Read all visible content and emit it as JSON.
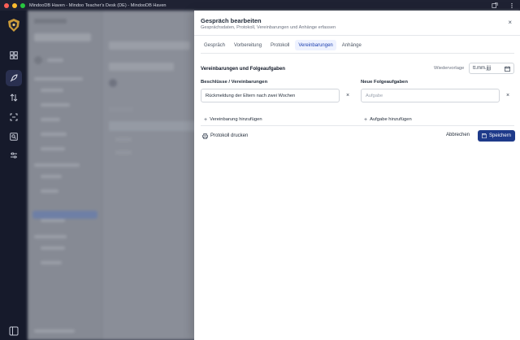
{
  "window": {
    "title": "MindooDB Haven - Mindoo Teacher's Desk (DE) - MindooDB Haven"
  },
  "rail": {
    "items": [
      {
        "icon": "dashboard-icon",
        "active": false
      },
      {
        "icon": "rocket-icon",
        "active": true
      },
      {
        "icon": "swap-icon",
        "active": false
      },
      {
        "icon": "scan-icon",
        "active": false
      },
      {
        "icon": "search-db-icon",
        "active": false
      },
      {
        "icon": "sliders-icon",
        "active": false
      }
    ]
  },
  "panel": {
    "title": "Gespräch bearbeiten",
    "subtitle": "Gesprächsdaten, Protokoll, Vereinbarungen und Anhänge erfassen",
    "close_label": "×",
    "tabs": [
      {
        "label": "Gespräch",
        "active": false
      },
      {
        "label": "Vorbereitung",
        "active": false
      },
      {
        "label": "Protokoll",
        "active": false
      },
      {
        "label": "Vereinbarungen",
        "active": true
      },
      {
        "label": "Anhänge",
        "active": false
      }
    ],
    "section_title": "Vereinbarungen und Folgeaufgaben",
    "wiedervorlage": {
      "label": "Wiedervorlage",
      "placeholder": "tt.mm.jjjj"
    },
    "agreements": {
      "label": "Beschlüsse / Vereinbarungen",
      "items": [
        {
          "value": "Rückmeldung der Eltern nach zwei Wochen"
        }
      ],
      "remove_label": "×",
      "add_label": "Vereinbarung hinzufügen"
    },
    "tasks": {
      "label": "Neue Folgeaufgaben",
      "items": [
        {
          "placeholder": "Aufgabe"
        }
      ],
      "remove_label": "×",
      "add_label": "Aufgabe hinzufügen"
    },
    "footer": {
      "print_label": "Protokoll drucken",
      "cancel_label": "Abbrechen",
      "save_label": "Speichern"
    }
  },
  "colors": {
    "accent": "#1e3a8a",
    "rail_bg": "#161a2b",
    "tab_active": "#1e40af"
  }
}
